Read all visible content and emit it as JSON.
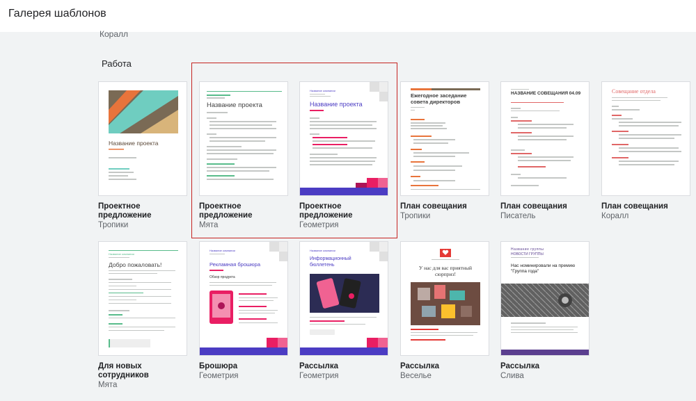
{
  "header": {
    "title": "Галерея шаблонов"
  },
  "previous_section": {
    "last_subtitle": "Коралл"
  },
  "section": {
    "title": "Работа"
  },
  "templates": [
    {
      "name": "Проектное предложение",
      "theme": "Тропики",
      "preview": {
        "title": "Название проекта"
      }
    },
    {
      "name": "Проектное предложение",
      "theme": "Мята",
      "preview": {
        "title": "Название проекта"
      }
    },
    {
      "name": "Проектное предложение",
      "theme": "Геометрия",
      "preview": {
        "company": "Название компании",
        "title": "Название проекта"
      }
    },
    {
      "name": "План совещания",
      "theme": "Тропики",
      "preview": {
        "title": "Ежегодное заседание совета директоров"
      }
    },
    {
      "name": "План совещания",
      "theme": "Писатель",
      "preview": {
        "title": "НАЗВАНИЕ СОВЕЩАНИЯ 04.09"
      }
    },
    {
      "name": "План совещания",
      "theme": "Коралл",
      "preview": {
        "title": "Совещание отдела"
      }
    },
    {
      "name": "Для новых сотрудников",
      "theme": "Мята",
      "preview": {
        "company": "Название компании",
        "title": "Добро пожаловать!"
      }
    },
    {
      "name": "Брошюра",
      "theme": "Геометрия",
      "preview": {
        "company": "Название компании",
        "title": "Рекламная брошюра",
        "heading": "Обзор продукта"
      }
    },
    {
      "name": "Рассылка",
      "theme": "Геометрия",
      "preview": {
        "company": "Название компании",
        "title": "Информационный бюллетень"
      }
    },
    {
      "name": "Рассылка",
      "theme": "Веселье",
      "preview": {
        "title": "У нас для вас приятный сюрприз!"
      }
    },
    {
      "name": "Рассылка",
      "theme": "Слива",
      "preview": {
        "company": "Название группы",
        "subtitle": "НОВОСТИ ГРУППЫ",
        "title": "Нас номинировали на премию \"Группа года\""
      }
    }
  ],
  "selected_template": {
    "name": "Проектное предложение",
    "theme": "Мята"
  },
  "colors": {
    "selection_border": "#c5221f",
    "teal": "#6fcdc0",
    "brown": "#7a6a55",
    "orange": "#e8743b",
    "mint_green": "#57bb8a",
    "geometry_purple": "#4b3cc3",
    "geometry_pink": "#e91e63",
    "coral_red": "#e06666",
    "plum": "#5b3f8f"
  }
}
